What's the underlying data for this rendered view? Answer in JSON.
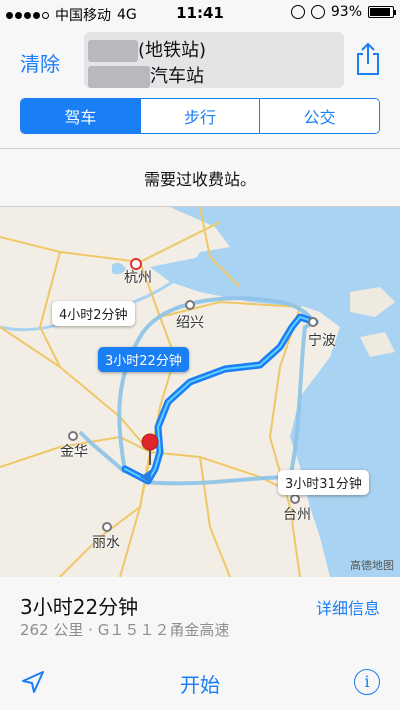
{
  "status_bar": {
    "carrier": "中国移动",
    "network": "4G",
    "time": "11:41",
    "battery": "93%",
    "battery_level": 0.93
  },
  "header": {
    "clear_label": "清除",
    "from_visible": "(地铁站)",
    "to_visible": "汽车站"
  },
  "transport_tabs": [
    {
      "label": "驾车",
      "active": true
    },
    {
      "label": "步行",
      "active": false
    },
    {
      "label": "公交",
      "active": false
    }
  ],
  "notice": "需要过收费站。",
  "map": {
    "cities": [
      {
        "name": "杭州"
      },
      {
        "name": "绍兴"
      },
      {
        "name": "宁波"
      },
      {
        "name": "金华"
      },
      {
        "name": "台州"
      },
      {
        "name": "丽水"
      }
    ],
    "callouts": [
      {
        "label": "4小时2分钟"
      },
      {
        "label": "3小时22分钟"
      },
      {
        "label": "3小时31分钟"
      }
    ],
    "credit": "高德地图",
    "colors": {
      "route_primary": "#1a7ef5",
      "route_alt": "#8ec3e8",
      "water": "#a9d3f2",
      "land": "#f2eee6"
    }
  },
  "route_summary": {
    "duration": "3小时22分钟",
    "detail": "262 公里 · G１５１２甬金高速",
    "details_label": "详细信息"
  },
  "toolbar": {
    "start_label": "开始"
  },
  "icons": {
    "share": "share-icon",
    "location": "location-arrow-icon",
    "info": "info-icon",
    "pin": "map-pin-icon"
  }
}
